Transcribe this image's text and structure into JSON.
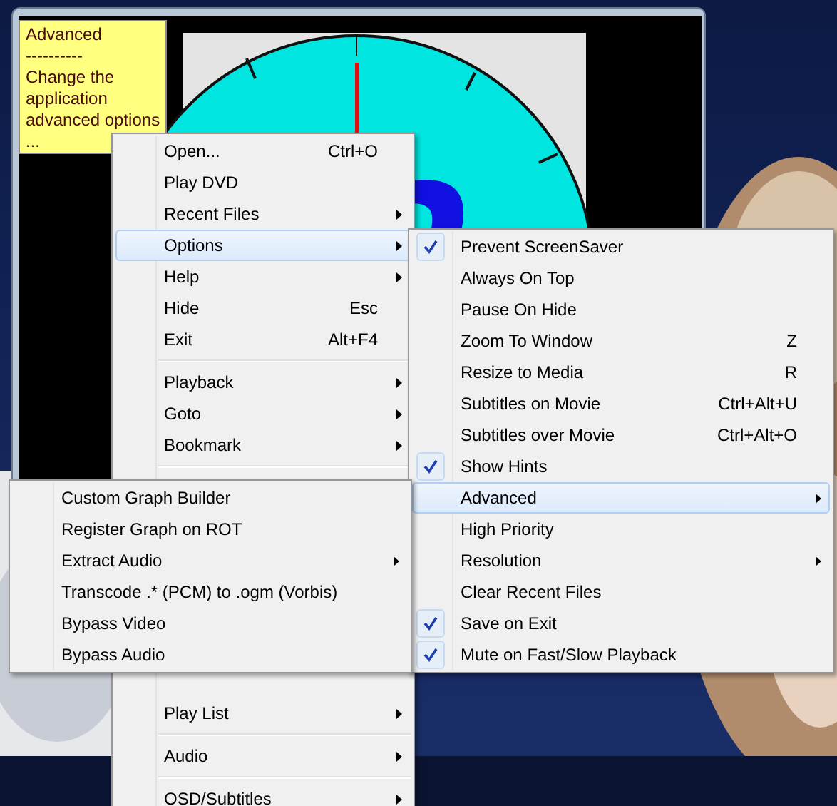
{
  "tooltip": {
    "title": "Advanced",
    "divider": "----------",
    "lines": [
      "Change the",
      "application",
      "advanced options",
      "..."
    ]
  },
  "main_menu": {
    "groups": [
      [
        {
          "label": "Open...",
          "shortcut": "Ctrl+O",
          "submenu": false,
          "selected": false
        },
        {
          "label": "Play DVD",
          "submenu": false,
          "selected": false
        },
        {
          "label": "Recent Files",
          "submenu": true,
          "selected": false
        },
        {
          "label": "Options",
          "submenu": true,
          "selected": true
        },
        {
          "label": "Help",
          "submenu": true,
          "selected": false
        },
        {
          "label": "Hide",
          "shortcut": "Esc",
          "submenu": false,
          "selected": false
        },
        {
          "label": "Exit",
          "shortcut": "Alt+F4",
          "submenu": false,
          "selected": false
        }
      ],
      [
        {
          "label": "Playback",
          "submenu": true,
          "selected": false
        },
        {
          "label": "Goto",
          "submenu": true,
          "selected": false
        },
        {
          "label": "Bookmark",
          "submenu": true,
          "selected": false
        }
      ],
      [
        {
          "label": "Play List",
          "submenu": true,
          "selected": false
        }
      ],
      [
        {
          "label": "Audio",
          "submenu": true,
          "selected": false
        }
      ],
      [
        {
          "label": "OSD/Subtitles",
          "submenu": true,
          "selected": false
        }
      ]
    ]
  },
  "options_menu": {
    "items": [
      {
        "label": "Prevent ScreenSaver",
        "checked": true,
        "submenu": false,
        "selected": false
      },
      {
        "label": "Always On Top",
        "checked": false,
        "submenu": false,
        "selected": false
      },
      {
        "label": "Pause On Hide",
        "checked": false,
        "submenu": false,
        "selected": false
      },
      {
        "label": "Zoom To Window",
        "shortcut": "Z",
        "checked": false,
        "submenu": false,
        "selected": false
      },
      {
        "label": "Resize to Media",
        "shortcut": "R",
        "checked": false,
        "submenu": false,
        "selected": false
      },
      {
        "label": "Subtitles on Movie",
        "shortcut": "Ctrl+Alt+U",
        "checked": false,
        "submenu": false,
        "selected": false
      },
      {
        "label": "Subtitles over Movie",
        "shortcut": "Ctrl+Alt+O",
        "checked": false,
        "submenu": false,
        "selected": false
      },
      {
        "label": "Show Hints",
        "checked": true,
        "submenu": false,
        "selected": false
      },
      {
        "label": "Advanced",
        "checked": false,
        "submenu": true,
        "selected": true
      },
      {
        "label": "High Priority",
        "checked": false,
        "submenu": false,
        "selected": false
      },
      {
        "label": "Resolution",
        "checked": false,
        "submenu": true,
        "selected": false
      },
      {
        "label": "Clear Recent Files",
        "checked": false,
        "submenu": false,
        "selected": false
      },
      {
        "label": "Save on Exit",
        "checked": true,
        "submenu": false,
        "selected": false
      },
      {
        "label": "Mute on Fast/Slow Playback",
        "checked": true,
        "submenu": false,
        "selected": false
      }
    ]
  },
  "advanced_menu": {
    "items": [
      {
        "label": "Custom Graph Builder",
        "submenu": false,
        "selected": false
      },
      {
        "label": "Register Graph on ROT",
        "submenu": false,
        "selected": false
      },
      {
        "label": "Extract Audio",
        "submenu": true,
        "selected": false
      },
      {
        "label": "Transcode .* (PCM) to .ogm (Vorbis)",
        "submenu": false,
        "selected": false
      },
      {
        "label": "Bypass Video",
        "submenu": false,
        "selected": false
      },
      {
        "label": "Bypass Audio",
        "submenu": false,
        "selected": false
      }
    ]
  }
}
